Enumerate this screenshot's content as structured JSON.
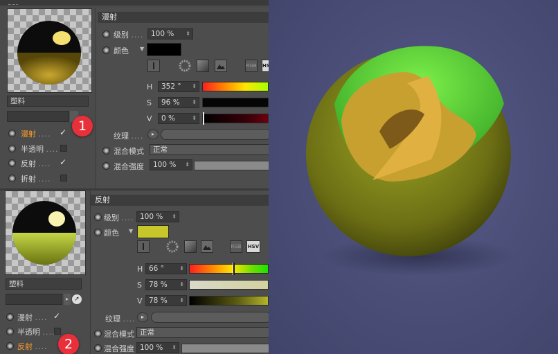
{
  "top": {
    "diffuse_header": "漫射",
    "level_label": "级别",
    "level_value": "100 %",
    "color_label": "颜色",
    "hsv_button": "HSV",
    "h_label": "H",
    "h_value": "352 °",
    "s_label": "S",
    "s_value": "96 %",
    "v_label": "V",
    "v_value": "0 %",
    "texture_label": "纹理",
    "blend_mode_label": "混合模式",
    "blend_mode_value": "正常",
    "blend_strength_label": "混合强度",
    "blend_strength_value": "100 %",
    "material_name": "塑料",
    "channels": [
      {
        "label": "漫射",
        "checked": true,
        "active": true
      },
      {
        "label": "半透明",
        "checked": false
      },
      {
        "label": "反射",
        "checked": true
      },
      {
        "label": "折射",
        "checked": false
      }
    ],
    "badge": "1"
  },
  "bottom": {
    "reflect_header": "反射",
    "level_label": "级别",
    "level_value": "100 %",
    "color_label": "颜色",
    "hsv_button": "HSV",
    "h_label": "H",
    "h_value": "66 °",
    "s_label": "S",
    "s_value": "78 %",
    "v_label": "V",
    "v_value": "78 %",
    "texture_label": "纹理",
    "blend_mode_label": "混合模式",
    "blend_mode_value": "正常",
    "blend_strength_label": "混合强度",
    "blend_strength_value": "100 %",
    "material_name": "塑料",
    "channels": [
      {
        "label": "漫射",
        "checked": true
      },
      {
        "label": "半透明",
        "checked": false
      },
      {
        "label": "反射",
        "checked": false,
        "active": true
      }
    ],
    "badge": "2"
  },
  "colors": {
    "top_swatch": "#000000",
    "bottom_swatch": "#c7c72b",
    "render_background": "#4a4e75",
    "sphere_gold": "#9c9a1f"
  },
  "dots": "....",
  "tick_char": "✓",
  "arrow_char": "▸"
}
